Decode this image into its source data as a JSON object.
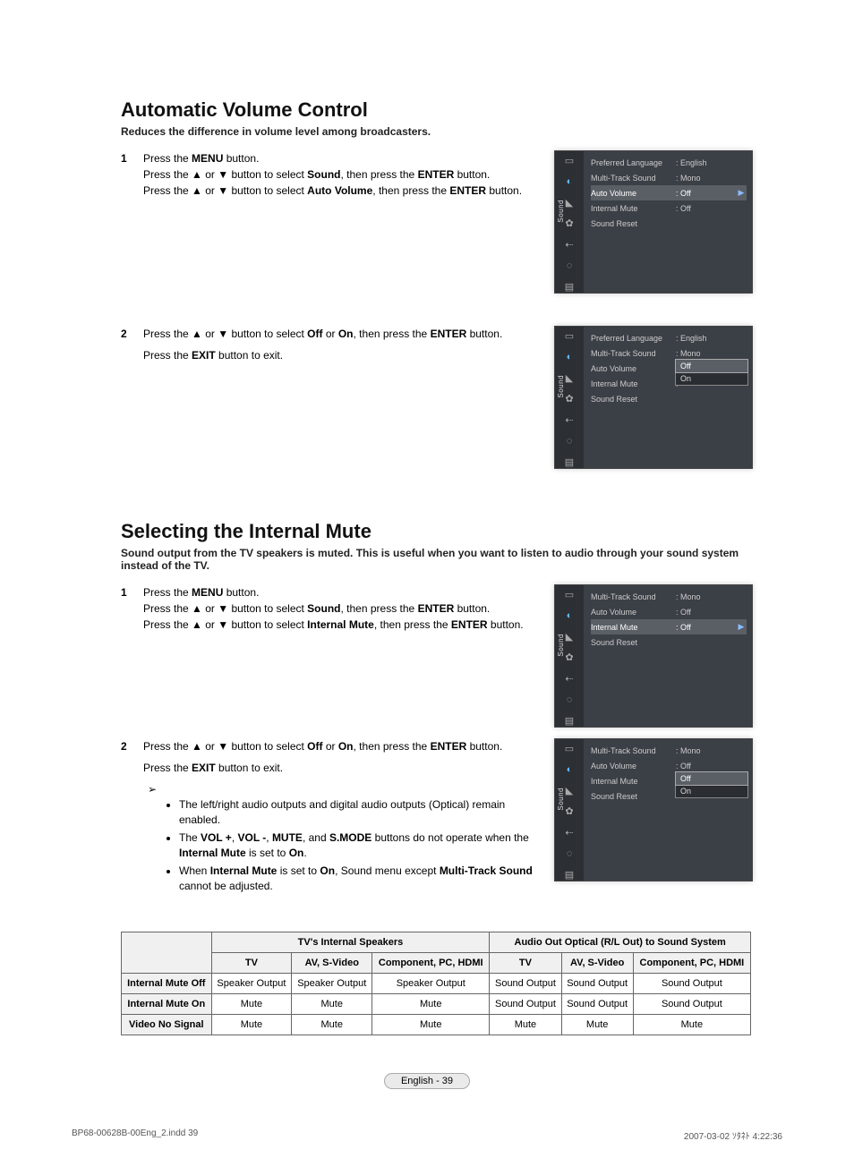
{
  "sections": {
    "auto_volume": {
      "title": "Automatic Volume Control",
      "desc": "Reduces the difference in volume level among broadcasters.",
      "step1": {
        "num": "1",
        "l1a": "Press the ",
        "l1b": "MENU",
        "l1c": " button.",
        "l2a": "Press the ▲ or ▼ button to select ",
        "l2b": "Sound",
        "l2c": ", then press the ",
        "l2d": "ENTER",
        "l2e": " button.",
        "l3a": "Press the ▲ or ▼ button to select ",
        "l3b": "Auto Volume",
        "l3c": ", then press the ",
        "l3d": "ENTER",
        "l3e": " button."
      },
      "step2": {
        "num": "2",
        "l1a": "Press the ▲ or ▼ button to select ",
        "l1b": "Off",
        "l1c": " or ",
        "l1d": "On",
        "l1e": ", then press the ",
        "l1f": "ENTER",
        "l1g": " button.",
        "l2a": "Press the ",
        "l2b": "EXIT",
        "l2c": " button to exit."
      }
    },
    "internal_mute": {
      "title": "Selecting the Internal Mute",
      "desc": "Sound output from the TV speakers is muted. This is useful when you want to listen to audio through your sound system instead of the TV.",
      "step1": {
        "num": "1",
        "l1a": "Press the ",
        "l1b": "MENU",
        "l1c": " button.",
        "l2a": "Press the ▲ or ▼ button to select ",
        "l2b": "Sound",
        "l2c": ", then press the ",
        "l2d": "ENTER",
        "l2e": " button.",
        "l3a": "Press the ▲ or ▼ button to select ",
        "l3b": "Internal Mute",
        "l3c": ", then press the ",
        "l3d": "ENTER",
        "l3e": " button."
      },
      "step2": {
        "num": "2",
        "l1a": "Press the ▲ or ▼ button to select ",
        "l1b": "Off",
        "l1c": " or ",
        "l1d": "On",
        "l1e": ", then press the ",
        "l1f": "ENTER",
        "l1g": " button.",
        "l2a": "Press the ",
        "l2b": "EXIT",
        "l2c": " button to exit.",
        "note_arrow": "➢",
        "b1": "The left/right audio outputs and digital audio outputs (Optical) remain enabled.",
        "b2a": "The ",
        "b2b": "VOL +",
        "b2c": ", ",
        "b2d": "VOL -",
        "b2e": ", ",
        "b2f": "MUTE",
        "b2g": ", and ",
        "b2h": "S.MODE",
        "b2i": " buttons do not operate when the ",
        "b2j": "Internal Mute",
        "b2k": " is set to ",
        "b2l": "On",
        "b2m": ".",
        "b3a": "When ",
        "b3b": "Internal Mute",
        "b3c": " is set to ",
        "b3d": "On",
        "b3e": ", Sound menu except ",
        "b3f": "Multi-Track Sound",
        "b3g": " cannot be adjusted."
      }
    }
  },
  "osd": {
    "sidebar_label": "Sound",
    "screen1": {
      "r1l": "Preferred Language",
      "r1v": ": English",
      "r2l": "Multi-Track Sound",
      "r2v": ": Mono",
      "r3l": "Auto Volume",
      "r3v": ": Off",
      "r3a": "▶",
      "r4l": "Internal Mute",
      "r4v": ": Off",
      "r5l": "Sound Reset"
    },
    "screen2": {
      "r1l": "Preferred Language",
      "r1v": ": English",
      "r2l": "Multi-Track Sound",
      "r2v": ": Mono",
      "r3l": "Auto Volume",
      "r3v": ":",
      "r4l": "Internal Mute",
      "r4v": ":",
      "r5l": "Sound Reset",
      "popup_off": "Off",
      "popup_on": "On"
    },
    "screen3": {
      "r1l": "Multi-Track Sound",
      "r1v": ": Mono",
      "r2l": "Auto Volume",
      "r2v": ": Off",
      "r3l": "Internal Mute",
      "r3v": ": Off",
      "r3a": "▶",
      "r4l": "Sound Reset"
    },
    "screen4": {
      "r1l": "Multi-Track Sound",
      "r1v": ": Mono",
      "r2l": "Auto Volume",
      "r2v": ": Off",
      "r3l": "Internal Mute",
      "r3v": ":",
      "r4l": "Sound Reset",
      "popup_off": "Off",
      "popup_on": "On"
    }
  },
  "table": {
    "h1": "TV's Internal Speakers",
    "h2": "Audio Out Optical (R/L Out) to Sound System",
    "sh1": "TV",
    "sh2": "AV, S-Video",
    "sh3": "Component, PC, HDMI",
    "sh4": "TV",
    "sh5": "AV, S-Video",
    "sh6": "Component, PC, HDMI",
    "r1h": "Internal Mute Off",
    "r1c1": "Speaker Output",
    "r1c2": "Speaker Output",
    "r1c3": "Speaker Output",
    "r1c4": "Sound Output",
    "r1c5": "Sound Output",
    "r1c6": "Sound Output",
    "r2h": "Internal Mute On",
    "r2c1": "Mute",
    "r2c2": "Mute",
    "r2c3": "Mute",
    "r2c4": "Sound Output",
    "r2c5": "Sound Output",
    "r2c6": "Sound Output",
    "r3h": "Video No Signal",
    "r3c1": "Mute",
    "r3c2": "Mute",
    "r3c3": "Mute",
    "r3c4": "Mute",
    "r3c5": "Mute",
    "r3c6": "Mute"
  },
  "footer": {
    "page": "English - 39",
    "print_left": "BP68-00628B-00Eng_2.indd   39",
    "print_right": "2007-03-02   ｿﾀﾈﾄ 4:22:36"
  }
}
